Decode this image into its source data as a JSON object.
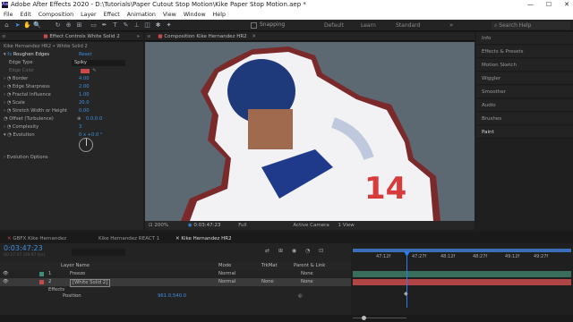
{
  "app": {
    "title": "Adobe After Effects 2020 - D:\\Tutorials\\Paper Cutout Stop Motion\\Kike Paper Stop Motion.aep *",
    "logo": "Ae",
    "menu": [
      "File",
      "Edit",
      "Composition",
      "Layer",
      "Effect",
      "Animation",
      "View",
      "Window",
      "Help"
    ],
    "window_buttons": [
      "—",
      "☐",
      "✕"
    ]
  },
  "toolbar": {
    "snapping_label": "Snapping",
    "workspaces": [
      "Default",
      "Learn",
      "Standard"
    ],
    "search_placeholder": "Search Help"
  },
  "effect_controls": {
    "tab_label": "Effect Controls White Solid 2",
    "subtitle": "Kike Hernandez HR2 • White Solid 2",
    "effect_name": "Roughen Edges",
    "reset_label": "Reset",
    "properties": [
      {
        "label": "Edge Type",
        "value": "Spiky"
      },
      {
        "label": "Edge Color",
        "value": ""
      },
      {
        "label": "Border",
        "value": "4.00"
      },
      {
        "label": "Edge Sharpness",
        "value": "2.00"
      },
      {
        "label": "Fractal Influence",
        "value": "1.00"
      },
      {
        "label": "Scale",
        "value": "20.0"
      },
      {
        "label": "Stretch Width or Height",
        "value": "0.00"
      },
      {
        "label": "Offset (Turbulence)",
        "value": "0.0,0.0"
      },
      {
        "label": "Complexity",
        "value": "3"
      },
      {
        "label": "Evolution",
        "value": "0 x +0.0 °"
      },
      {
        "label": "Evolution Options",
        "value": ""
      }
    ]
  },
  "composition": {
    "tab_label": "Composition Kike Hernandez HR2",
    "jersey_number": "14",
    "zoom": "200%",
    "timecode": "0:03:47:23",
    "resolution": "Full",
    "camera": "Active Camera",
    "view": "1 View"
  },
  "right_panel": {
    "items": [
      "Info",
      "Effects & Presets",
      "Motion Sketch",
      "Wiggler",
      "Smoother",
      "Audio",
      "Brushes",
      "Paint"
    ]
  },
  "timeline": {
    "tabs": [
      "GBFX Kike Hernandez",
      "Kike Hernandez REACT 1",
      "Kike Hernandez HR2"
    ],
    "timecode": "0:03:47:23",
    "frame_info": "00:27:47 (29.97 fps)",
    "columns": {
      "layer_name": "Layer Name",
      "mode": "Mode",
      "trkmat": "TrkMat",
      "parent": "Parent & Link"
    },
    "layers": [
      {
        "num": "1",
        "name": "Freeze",
        "mode": "Normal",
        "trkmat": "",
        "parent": "None"
      },
      {
        "num": "2",
        "name": "[White Solid 2]",
        "mode": "Normal",
        "trkmat": "None",
        "parent": "None"
      }
    ],
    "effects_label": "Effects",
    "position_label": "Position",
    "position_value": "961.0,540.0",
    "ruler": [
      "47:12f",
      "47:27f",
      "48:12f",
      "48:27f",
      "49:12f",
      "49:27f"
    ]
  },
  "colors": {
    "accent_blue": "#3d8fe0",
    "label_red": "#c94a4a",
    "playhead": "#2f7bf0"
  }
}
